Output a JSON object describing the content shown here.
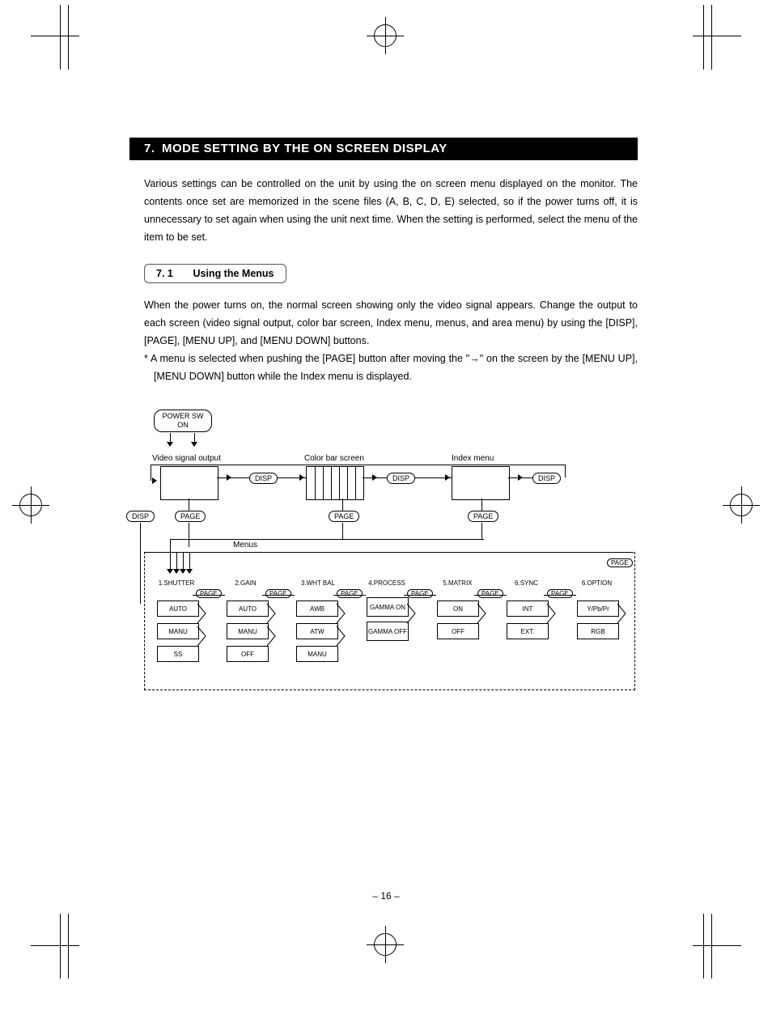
{
  "section": {
    "number": "7.",
    "title": "MODE SETTING BY THE ON SCREEN DISPLAY"
  },
  "intro": "Various settings can be controlled on the unit by using the on screen menu displayed on the monitor. The contents once set are memorized in the scene files (A, B, C, D, E) selected, so if the power turns off, it is unnecessary to set again when using the unit next time. When the setting is performed, select the menu of the item to be set.",
  "sub": {
    "number": "7.  1",
    "title": "Using the Menus"
  },
  "body1": "When the power turns on, the normal screen showing only the video signal appears. Change the output to each screen (video signal output, color bar screen, Index menu, menus, and area menu) by using the [DISP], [PAGE], [MENU UP], and [MENU DOWN] buttons.",
  "note": "* A menu is selected when pushing the [PAGE] button after moving the \"→\" on the screen by the [MENU UP], [MENU DOWN] button while the Index menu is displayed.",
  "page_number": "– 16 –",
  "diagram": {
    "power": "POWER SW\nON",
    "screens": [
      "Video signal output",
      "Color bar screen",
      "Index menu"
    ],
    "btn_disp": "DISP",
    "btn_page": "PAGE",
    "menus_label": "Menus",
    "menus": [
      {
        "title": "1.SHUTTER",
        "rows": [
          "AUTO",
          "MANU",
          "SS"
        ]
      },
      {
        "title": "2.GAIN",
        "rows": [
          "AUTO",
          "MANU",
          "OFF"
        ]
      },
      {
        "title": "3.WHT BAL",
        "rows": [
          "AWB",
          "ATW",
          "MANU"
        ]
      },
      {
        "title": "4.PROCESS",
        "rows": [
          "GAMMA ON",
          "GAMMA OFF"
        ]
      },
      {
        "title": "5.MATRIX",
        "rows": [
          "ON",
          "OFF"
        ]
      },
      {
        "title": "6.SYNC",
        "rows": [
          "INT",
          "EXT."
        ]
      },
      {
        "title": "6.OPTION",
        "rows": [
          "Y/Pb/Pr",
          "RGB"
        ]
      }
    ]
  }
}
